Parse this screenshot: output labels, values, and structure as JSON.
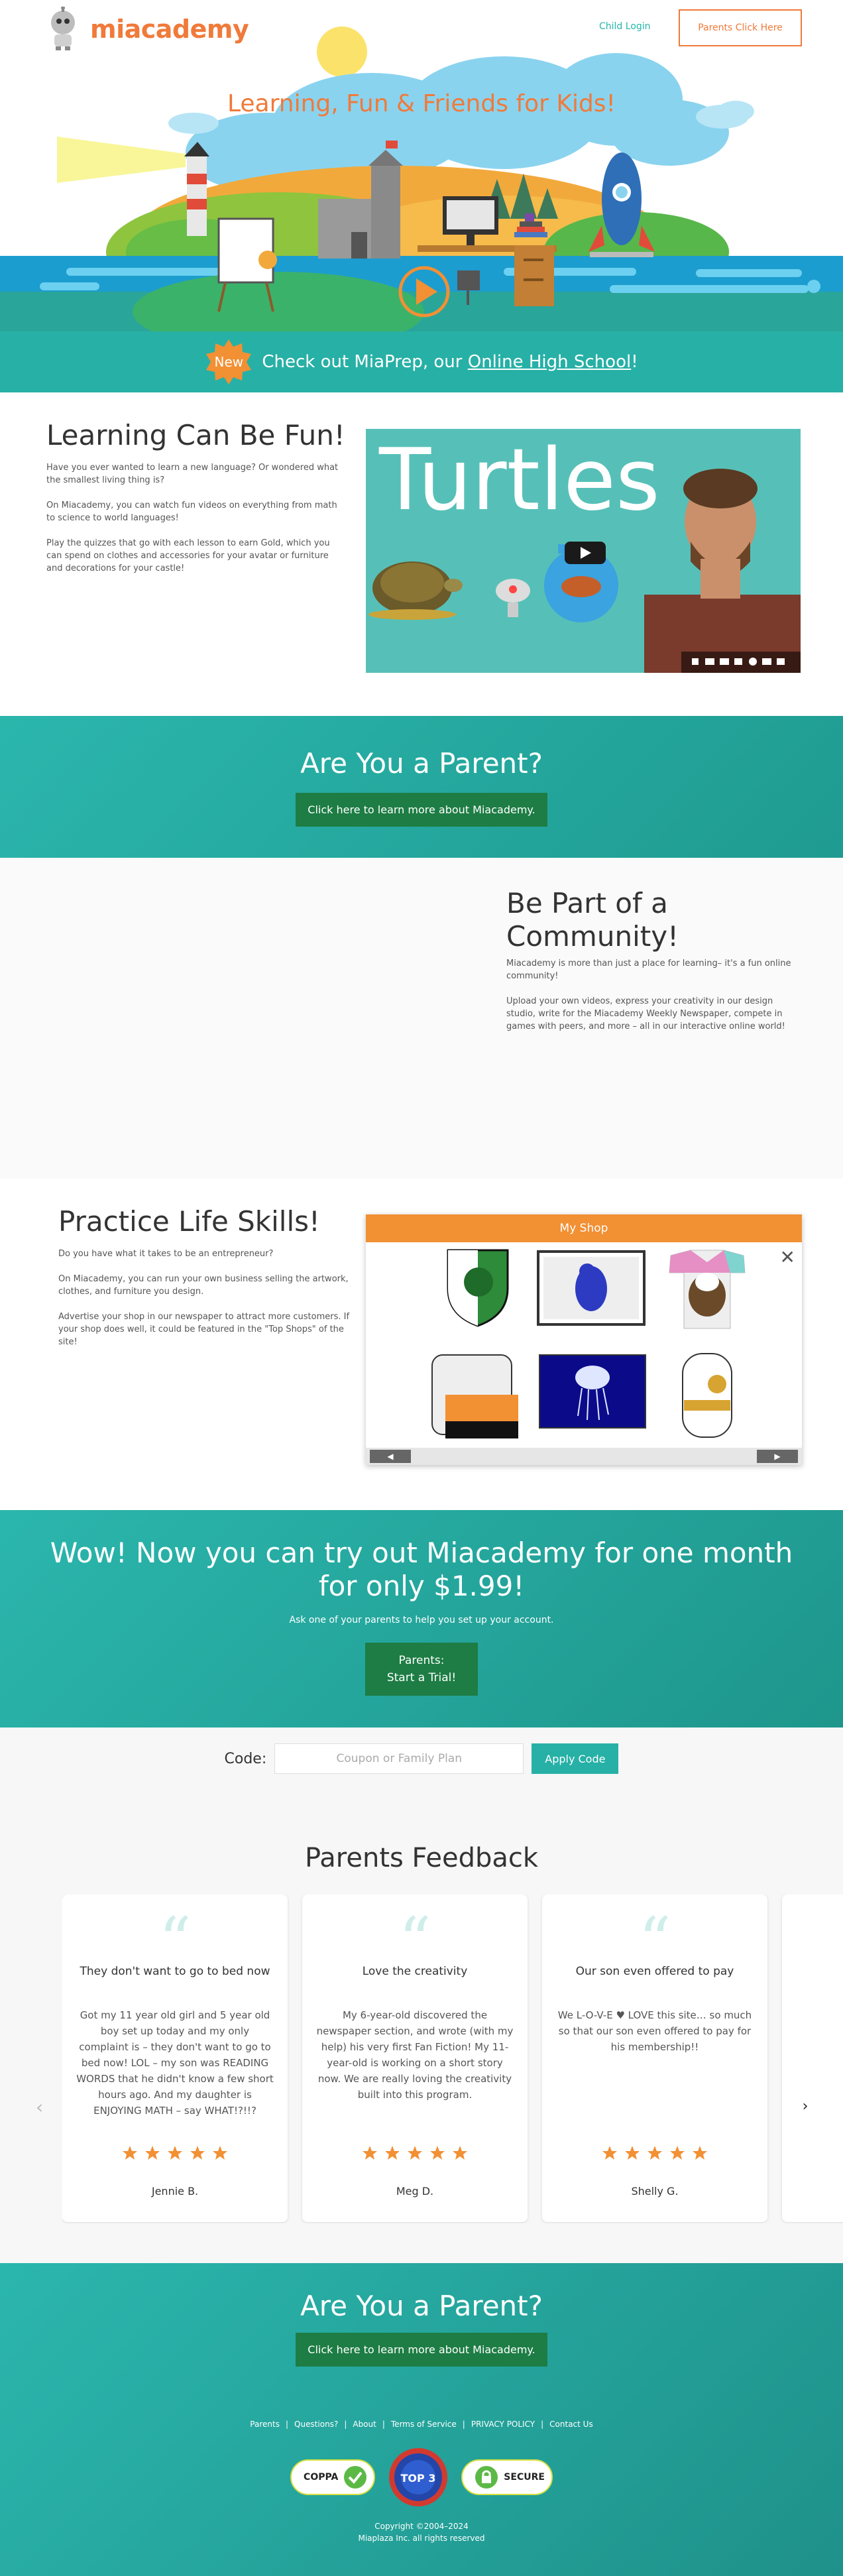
{
  "header": {
    "logo_text": "miacademy",
    "child_login": "Child Login",
    "parents_button": "Parents Click Here",
    "hero_title": "Learning, Fun & Friends for Kids!"
  },
  "new_banner": {
    "badge": "New",
    "text_before": "Check out MiaPrep, our ",
    "link": "Online High School",
    "text_after": "!"
  },
  "learning": {
    "title": "Learning Can Be Fun!",
    "paragraphs": [
      "Have you ever wanted to learn a new language? Or wondered what the smallest living thing is?",
      "On Miacademy, you can watch fun videos on everything from math to science to world languages!",
      "Play the quizzes that go with each lesson to earn Gold, which you can spend on clothes and accessories for your avatar or furniture and decorations for your castle!"
    ],
    "video_title": "Turtles"
  },
  "parent_band": {
    "title": "Are You a Parent?",
    "button": "Click here to learn more about Miacademy."
  },
  "community": {
    "title": "Be Part of a Community!",
    "paragraphs": [
      "Miacademy is more than just a place for learning– it's a fun online community!",
      "Upload your own videos, express your creativity in our design studio, write for the Miacademy Weekly Newspaper, compete in games with peers, and more – all in our interactive online world!"
    ]
  },
  "skills": {
    "title": "Practice Life Skills!",
    "paragraphs": [
      "Do you have what it takes to be an entrepreneur?",
      "On Miacademy, you can run your own business selling the artwork, clothes, and furniture you design.",
      "Advertise your shop in our newspaper to attract more customers. If your shop does well, it could be featured in the \"Top Shops\" of the site!"
    ],
    "shop_title": "My Shop"
  },
  "trial": {
    "title": "Wow! Now you can try out Miacademy for one month for only $1.99!",
    "subtitle": "Ask one of your parents to help you set up your account.",
    "button_line1": "Parents:",
    "button_line2": "Start a Trial!"
  },
  "code": {
    "label": "Code:",
    "placeholder": "Coupon or Family Plan",
    "button": "Apply Code"
  },
  "feedback": {
    "title": "Parents Feedback",
    "cards": [
      {
        "title": "They don't want to go to bed now",
        "body": "Got my 11 year old girl and 5 year old boy set up today and my only complaint is – they don't want to go to bed now! LOL – my son was READING WORDS that he didn't know a few short hours ago. And my daughter is ENJOYING MATH – say WHAT!?!!?",
        "name": "Jennie B."
      },
      {
        "title": "Love the creativity",
        "body": "My 6-year-old discovered the newspaper section, and wrote (with my help) his very first Fan Fiction! My 11-year-old is working on a short story now. We are really loving the creativity built into this program.",
        "name": "Meg D."
      },
      {
        "title": "Our son even offered to pay",
        "body": "We L-O-V-E ♥ LOVE this site… so much so that our son even offered to pay for his membership!!",
        "name": "Shelly G."
      }
    ],
    "stars": 5
  },
  "footer": {
    "title": "Are You a Parent?",
    "button": "Click here to learn more about Miacademy.",
    "links": [
      "Parents",
      "Questions?",
      "About",
      "Terms of Service",
      "PRIVACY POLICY",
      "Contact Us"
    ],
    "badges": {
      "coppa": "COPPA",
      "top3_line1": "TOP 3",
      "secure": "SECURE"
    },
    "copyright_line1": "Copyright ©2004–2024",
    "copyright_line2": "Miaplaza Inc. all rights reserved"
  },
  "colors": {
    "brand_orange": "#f07a3a",
    "teal": "#27b0a6",
    "green_button": "#1d7d44",
    "star": "#f29034"
  },
  "icons": [
    "robot-logo-icon",
    "sun-icon",
    "play-icon",
    "quote-icon",
    "star-icon",
    "close-icon",
    "chevron-left-icon",
    "chevron-right-icon",
    "checkmark-icon"
  ]
}
